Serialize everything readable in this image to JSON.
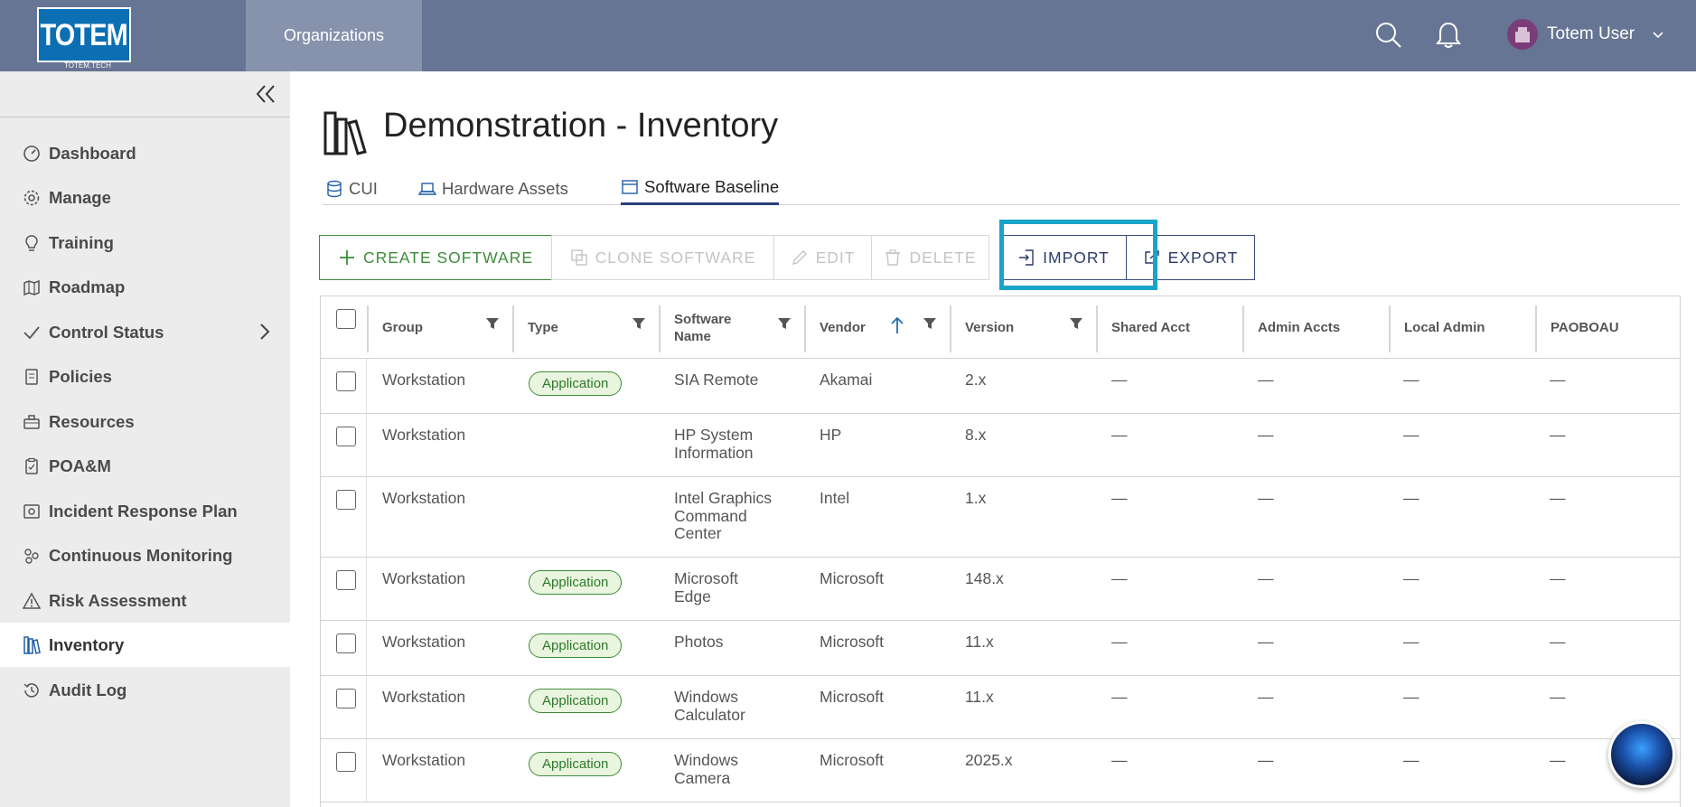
{
  "header": {
    "logo_text": "TOTEM",
    "logo_sub": "TOTEM.TECH",
    "nav_label": "Organizations",
    "user_name": "Totem User"
  },
  "sidebar": {
    "items": [
      {
        "label": "Dashboard",
        "icon": "gauge-icon"
      },
      {
        "label": "Manage",
        "icon": "gear-icon"
      },
      {
        "label": "Training",
        "icon": "lightbulb-icon"
      },
      {
        "label": "Roadmap",
        "icon": "map-icon"
      },
      {
        "label": "Control Status",
        "icon": "check-icon"
      },
      {
        "label": "Policies",
        "icon": "document-icon"
      },
      {
        "label": "Resources",
        "icon": "toolbox-icon"
      },
      {
        "label": "POA&M",
        "icon": "clipboard-icon"
      },
      {
        "label": "Incident Response Plan",
        "icon": "safe-icon"
      },
      {
        "label": "Continuous Monitoring",
        "icon": "cycle-icon"
      },
      {
        "label": "Risk Assessment",
        "icon": "warning-icon"
      },
      {
        "label": "Inventory",
        "icon": "books-icon"
      },
      {
        "label": "Audit Log",
        "icon": "history-icon"
      }
    ],
    "active": "Inventory"
  },
  "page": {
    "title": "Demonstration - Inventory",
    "tabs": [
      {
        "label": "CUI",
        "icon": "database-icon"
      },
      {
        "label": "Hardware Assets",
        "icon": "laptop-icon"
      },
      {
        "label": "Software Baseline",
        "icon": "window-icon"
      }
    ],
    "active_tab": "Software Baseline"
  },
  "toolbar": {
    "create": "CREATE SOFTWARE",
    "clone": "CLONE SOFTWARE",
    "edit": "EDIT",
    "delete": "DELETE",
    "import": "IMPORT",
    "export": "EXPORT"
  },
  "table": {
    "columns": [
      "Group",
      "Type",
      "Software Name",
      "Vendor",
      "Version",
      "Shared Acct",
      "Admin Accts",
      "Local Admin",
      "PAOBOAU"
    ],
    "rows": [
      {
        "group": "Workstation",
        "type": "Application",
        "name": "SIA Remote",
        "vendor": "Akamai",
        "version": "2.x",
        "shared": "—",
        "admin": "—",
        "local": "—",
        "paoboau": "—"
      },
      {
        "group": "Workstation",
        "type": "",
        "name": "HP System Information",
        "vendor": "HP",
        "version": "8.x",
        "shared": "—",
        "admin": "—",
        "local": "—",
        "paoboau": "—"
      },
      {
        "group": "Workstation",
        "type": "",
        "name": "Intel Graphics Command Center",
        "vendor": "Intel",
        "version": "1.x",
        "shared": "—",
        "admin": "—",
        "local": "—",
        "paoboau": "—"
      },
      {
        "group": "Workstation",
        "type": "Application",
        "name": "Microsoft Edge",
        "vendor": "Microsoft",
        "version": "148.x",
        "shared": "—",
        "admin": "—",
        "local": "—",
        "paoboau": "—"
      },
      {
        "group": "Workstation",
        "type": "Application",
        "name": "Photos",
        "vendor": "Microsoft",
        "version": "11.x",
        "shared": "—",
        "admin": "—",
        "local": "—",
        "paoboau": "—"
      },
      {
        "group": "Workstation",
        "type": "Application",
        "name": "Windows Calculator",
        "vendor": "Microsoft",
        "version": "11.x",
        "shared": "—",
        "admin": "—",
        "local": "—",
        "paoboau": "—"
      },
      {
        "group": "Workstation",
        "type": "Application",
        "name": "Windows Camera",
        "vendor": "Microsoft",
        "version": "2025.x",
        "shared": "—",
        "admin": "—",
        "local": "—",
        "paoboau": "—"
      }
    ]
  },
  "colors": {
    "header_bg": "#677594",
    "accent_green": "#3d8c3a",
    "accent_navy": "#2b3a66",
    "highlight": "#1aa4c8"
  }
}
